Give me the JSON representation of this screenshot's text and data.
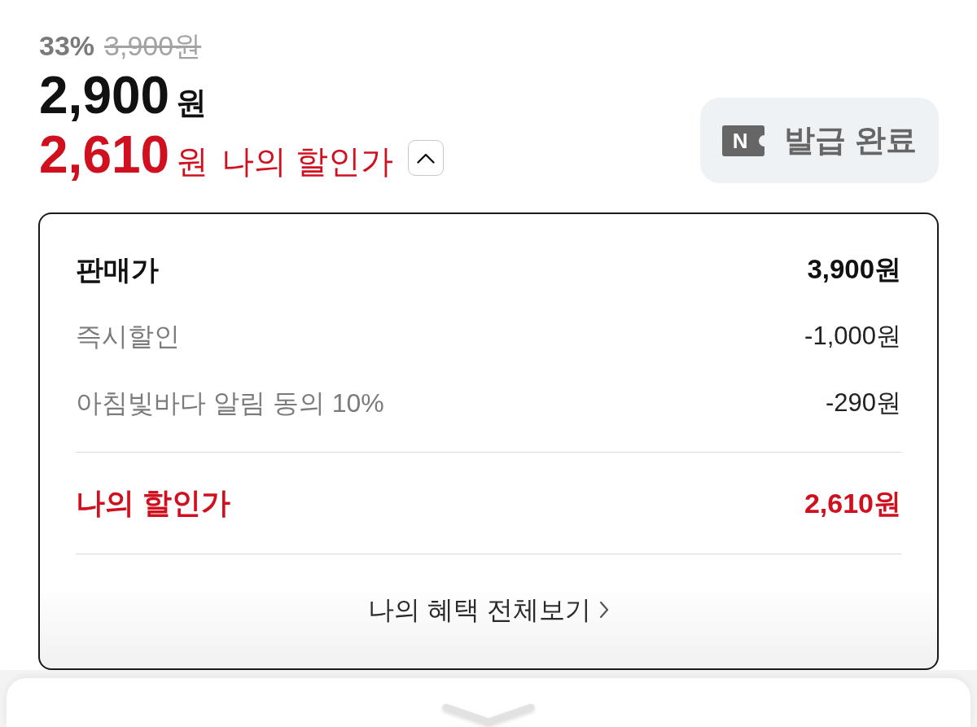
{
  "price": {
    "discount_rate": "33%",
    "original_price": "3,900원",
    "sale_amount": "2,900",
    "sale_unit": "원",
    "my_amount": "2,610",
    "my_unit": "원",
    "my_label": "나의 할인가"
  },
  "breakdown_toggle": {
    "expanded": true
  },
  "coupon": {
    "badge_letter": "N",
    "label": "발급 완료",
    "disabled": true
  },
  "breakdown": {
    "rows": [
      {
        "kind": "base",
        "label": "판매가",
        "amount": "3,900원"
      },
      {
        "kind": "discount",
        "label": "즉시할인",
        "amount": "-1,000원"
      },
      {
        "kind": "discount",
        "label": "아침빛바다 알림 동의 10%",
        "amount": "-290원"
      },
      {
        "kind": "final",
        "label": "나의 할인가",
        "amount": "2,610원"
      }
    ],
    "link": "나의 혜택 전체보기"
  }
}
